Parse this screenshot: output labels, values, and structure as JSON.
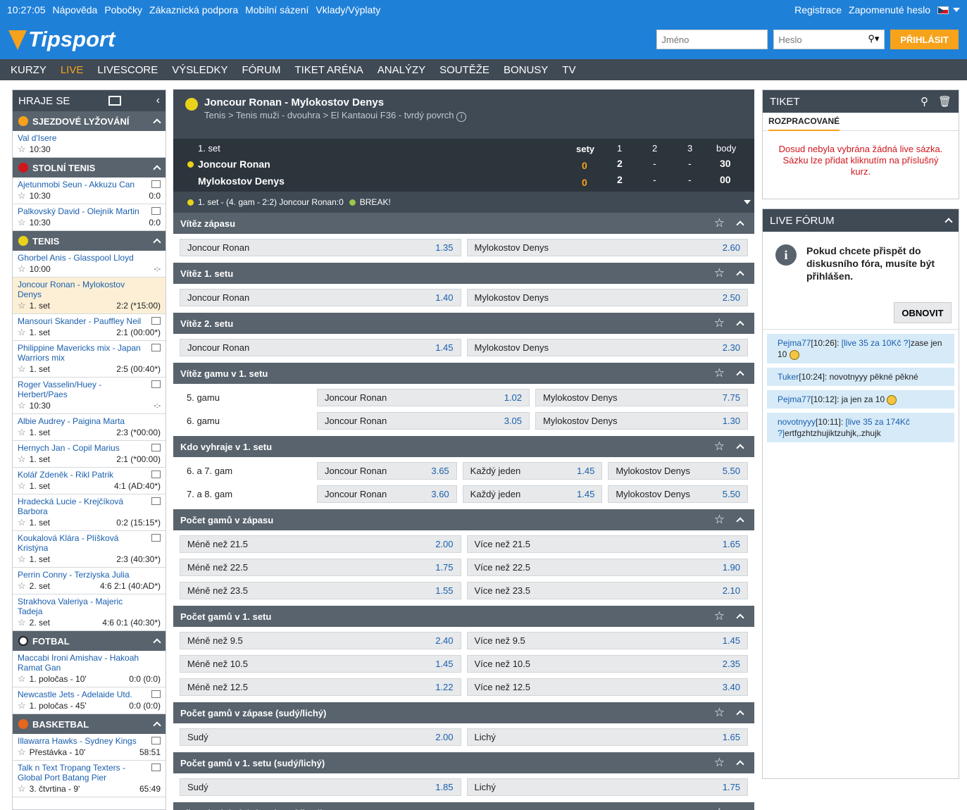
{
  "topbar": {
    "time": "10:27:05",
    "links": [
      "Nápověda",
      "Pobočky",
      "Zákaznická podpora",
      "Mobilní sázení",
      "Vklady/Výplaty"
    ],
    "register": "Registrace",
    "forgot": "Zapomenuté heslo"
  },
  "header": {
    "logo": "Tipsport",
    "username_placeholder": "Jméno",
    "password_placeholder": "Heslo",
    "login_label": "PŘIHLÁSIT"
  },
  "nav": [
    "KURZY",
    "LIVE",
    "LIVESCORE",
    "VÝSLEDKY",
    "FÓRUM",
    "TIKET ARÉNA",
    "ANALÝZY",
    "SOUTĚŽE",
    "BONUSY",
    "TV"
  ],
  "left": {
    "title": "HRAJE SE",
    "sports": [
      {
        "name": "SJEZDOVÉ LYŽOVÁNÍ",
        "color": "#f7a21b",
        "matches": [
          {
            "name": "Val d'Isere",
            "status": "10:30",
            "score": "",
            "tv": false
          }
        ]
      },
      {
        "name": "STOLNÍ TENIS",
        "color": "#d0161c",
        "matches": [
          {
            "name": "Ajetunmobi Seun - Akkuzu Can",
            "status": "10:30",
            "score": "0:0",
            "tv": true
          },
          {
            "name": "Palkovský David - Olejník Martin",
            "status": "10:30",
            "score": "0:0",
            "tv": true
          }
        ]
      },
      {
        "name": "TENIS",
        "color": "#e8d21a",
        "matches": [
          {
            "name": "Ghorbel Anis - Glasspool Lloyd",
            "status": "10:00",
            "score": "-:-",
            "tv": false
          },
          {
            "name": "Joncour Ronan - Mylokostov Denys",
            "status": "1. set",
            "score": "2:2 (*15:00)",
            "tv": false,
            "sel": true
          },
          {
            "name": "Mansouri Skander - Pauffley Neil",
            "status": "1. set",
            "score": "2:1 (00:00*)",
            "tv": true
          },
          {
            "name": "Philippine Mavericks mix - Japan Warriors mix",
            "status": "1. set",
            "score": "2:5 (00:40*)",
            "tv": true
          },
          {
            "name": "Roger Vasselin/Huey - Herbert/Paes",
            "status": "10:30",
            "score": "-:-",
            "tv": true
          },
          {
            "name": "Albie Audrey - Paigina Marta",
            "status": "1. set",
            "score": "2:3 (*00:00)",
            "tv": false
          },
          {
            "name": "Hernych Jan - Copil Marius",
            "status": "1. set",
            "score": "2:1 (*00:00)",
            "tv": true
          },
          {
            "name": "Kolář Zdeněk - Rikl Patrik",
            "status": "1. set",
            "score": "4:1 (AD:40*)",
            "tv": true
          },
          {
            "name": "Hradecká Lucie - Krejčíková Barbora",
            "status": "1. set",
            "score": "0:2 (15:15*)",
            "tv": true
          },
          {
            "name": "Koukalová Klára - Plíšková Kristýna",
            "status": "1. set",
            "score": "2:3 (40:30*)",
            "tv": true
          },
          {
            "name": "Perrin Conny - Terziyska Julia",
            "status": "2. set",
            "score": "4:6 2:1 (40:AD*)",
            "tv": false
          },
          {
            "name": "Strakhova Valeriya - Majeric Tadeja",
            "status": "2. set",
            "score": "4:6 0:1 (40:30*)",
            "tv": false
          }
        ]
      },
      {
        "name": "FOTBAL",
        "color": "#ffffff",
        "matches": [
          {
            "name": "Maccabi Ironi Amishav - Hakoah Ramat Gan",
            "status": "1. poločas - 10'",
            "score": "0:0 (0:0)",
            "tv": false
          },
          {
            "name": "Newcastle Jets - Adelaide Utd.",
            "status": "1. poločas - 45'",
            "score": "0:0 (0:0)",
            "tv": true
          }
        ]
      },
      {
        "name": "BASKETBAL",
        "color": "#e5671e",
        "matches": [
          {
            "name": "Illawarra Hawks - Sydney Kings",
            "status": "Přestávka - 10'",
            "score": "58:51",
            "tv": true
          },
          {
            "name": "Talk n Text Tropang Texters - Global Port Batang Pier",
            "status": "3. čtvrtina - 9'",
            "score": "65:49",
            "tv": true
          }
        ]
      }
    ]
  },
  "event": {
    "title": "Joncour Ronan - Mylokostov Denys",
    "breadcrumb": "Tenis > Tenis muži - dvouhra > El Kantaoui F36 - tvrdý povrch",
    "set_label": "1. set",
    "col_sets": "sety",
    "col_1": "1",
    "col_2": "2",
    "col_3": "3",
    "col_points": "body",
    "p1": {
      "name": "Joncour Ronan",
      "sets": "0",
      "s1": "2",
      "s2": "-",
      "s3": "-",
      "points": "30"
    },
    "p2": {
      "name": "Mylokostov Denys",
      "sets": "0",
      "s1": "2",
      "s2": "-",
      "s3": "-",
      "points": "00"
    },
    "last_event": "1. set - (4. gam - 2:2) Joncour Ronan:0",
    "break_label": "BREAK!"
  },
  "markets": [
    {
      "title": "Vítěz zápasu",
      "rows": [
        {
          "odds": [
            [
              "Joncour Ronan",
              "1.35"
            ],
            [
              "Mylokostov Denys",
              "2.60"
            ]
          ]
        }
      ]
    },
    {
      "title": "Vítěz 1. setu",
      "rows": [
        {
          "odds": [
            [
              "Joncour Ronan",
              "1.40"
            ],
            [
              "Mylokostov Denys",
              "2.50"
            ]
          ]
        }
      ]
    },
    {
      "title": "Vítěz 2. setu",
      "rows": [
        {
          "odds": [
            [
              "Joncour Ronan",
              "1.45"
            ],
            [
              "Mylokostov Denys",
              "2.30"
            ]
          ]
        }
      ]
    },
    {
      "title": "Vítěz gamu v 1. setu",
      "rows": [
        {
          "label": "5. gamu",
          "odds": [
            [
              "Joncour Ronan",
              "1.02"
            ],
            [
              "Mylokostov Denys",
              "7.75"
            ]
          ]
        },
        {
          "label": "6. gamu",
          "odds": [
            [
              "Joncour Ronan",
              "3.05"
            ],
            [
              "Mylokostov Denys",
              "1.30"
            ]
          ]
        }
      ]
    },
    {
      "title": "Kdo vyhraje v 1. setu",
      "rows": [
        {
          "label": "6. a 7. gam",
          "odds": [
            [
              "Joncour Ronan",
              "3.65"
            ],
            [
              "Každý jeden",
              "1.45"
            ],
            [
              "Mylokostov Denys",
              "5.50"
            ]
          ]
        },
        {
          "label": "7. a 8. gam",
          "odds": [
            [
              "Joncour Ronan",
              "3.60"
            ],
            [
              "Každý jeden",
              "1.45"
            ],
            [
              "Mylokostov Denys",
              "5.50"
            ]
          ]
        }
      ]
    },
    {
      "title": "Počet gamů v zápasu",
      "rows": [
        {
          "odds": [
            [
              "Méně než 21.5",
              "2.00"
            ],
            [
              "Více než 21.5",
              "1.65"
            ]
          ]
        },
        {
          "odds": [
            [
              "Méně než 22.5",
              "1.75"
            ],
            [
              "Více než 22.5",
              "1.90"
            ]
          ]
        },
        {
          "odds": [
            [
              "Méně než 23.5",
              "1.55"
            ],
            [
              "Více než 23.5",
              "2.10"
            ]
          ]
        }
      ]
    },
    {
      "title": "Počet gamů v 1. setu",
      "rows": [
        {
          "odds": [
            [
              "Méně než 9.5",
              "2.40"
            ],
            [
              "Více než 9.5",
              "1.45"
            ]
          ]
        },
        {
          "odds": [
            [
              "Méně než 10.5",
              "1.45"
            ],
            [
              "Více než 10.5",
              "2.35"
            ]
          ]
        },
        {
          "odds": [
            [
              "Méně než 12.5",
              "1.22"
            ],
            [
              "Více než 12.5",
              "3.40"
            ]
          ]
        }
      ]
    },
    {
      "title": "Počet gamů v zápase (sudý/lichý)",
      "rows": [
        {
          "odds": [
            [
              "Sudý",
              "2.00"
            ],
            [
              "Lichý",
              "1.65"
            ]
          ]
        }
      ]
    },
    {
      "title": "Počet gamů v 1. setu (sudý/lichý)",
      "rows": [
        {
          "odds": [
            [
              "Sudý",
              "1.85"
            ],
            [
              "Lichý",
              "1.75"
            ]
          ]
        }
      ]
    },
    {
      "title": "Přesný výsledek (na dva vítězné)",
      "rows": []
    }
  ],
  "ticket": {
    "title": "TIKET",
    "tab": "ROZPRACOVANÉ",
    "message": "Dosud nebyla vybrána žádná live sázka. Sázku lze přidat kliknutím na příslušný kurz."
  },
  "forum": {
    "title": "LIVE FÓRUM",
    "info": "Pokud chcete přispět do diskusního fóra, musíte být přihlášen.",
    "refresh": "OBNOVIT",
    "posts": [
      {
        "user": "Pejma77",
        "time": "[10:26]:",
        "link": "[live 35 za 10Kč ?]",
        "text": "zase jen 10",
        "smile": true
      },
      {
        "user": "Tuker",
        "time": "[10:24]:",
        "link": "",
        "text": "novotnyyy pěkné pěkné",
        "smile": false
      },
      {
        "user": "Pejma77",
        "time": "[10:12]:",
        "link": "",
        "text": "ja jen za 10",
        "smile": true
      },
      {
        "user": "novotnyyy",
        "time": "[10:11]:",
        "link": "[live 35 za 174Kč ?]",
        "text": "ertfgzhtzhujiktzuhjk,.zhujk",
        "smile": false
      }
    ]
  }
}
